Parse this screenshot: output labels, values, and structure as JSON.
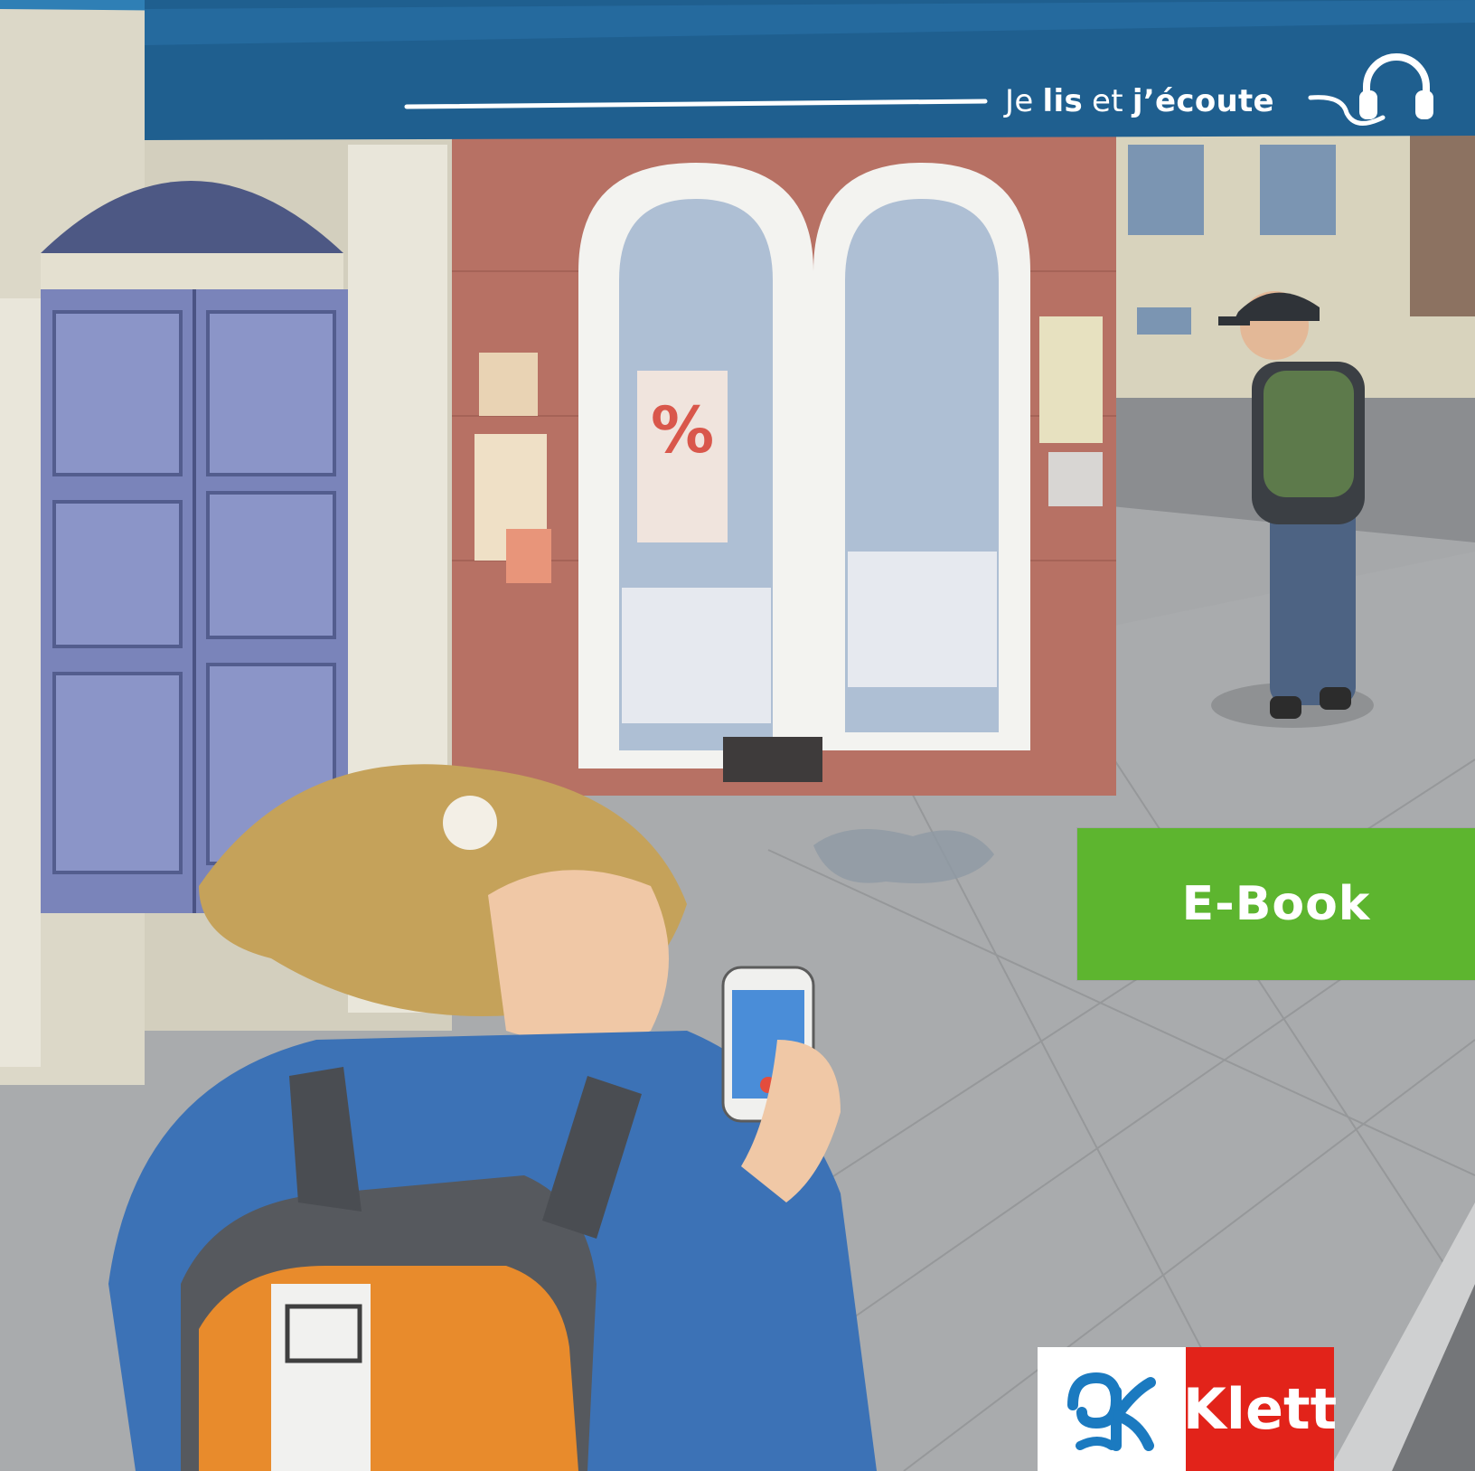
{
  "cover": {
    "series_line": {
      "word1": "Je",
      "word2": "lis",
      "word3": "et",
      "word4": "j’écoute"
    },
    "badge_label": "E-Book",
    "publisher": "Klett"
  },
  "colors": {
    "banner": "#1f5f8f",
    "badge": "#5db52f",
    "publisher_red": "#e2231a",
    "publisher_blue": "#1b7ac0"
  },
  "icons": [
    "headphones-icon",
    "klett-logo-mark"
  ]
}
